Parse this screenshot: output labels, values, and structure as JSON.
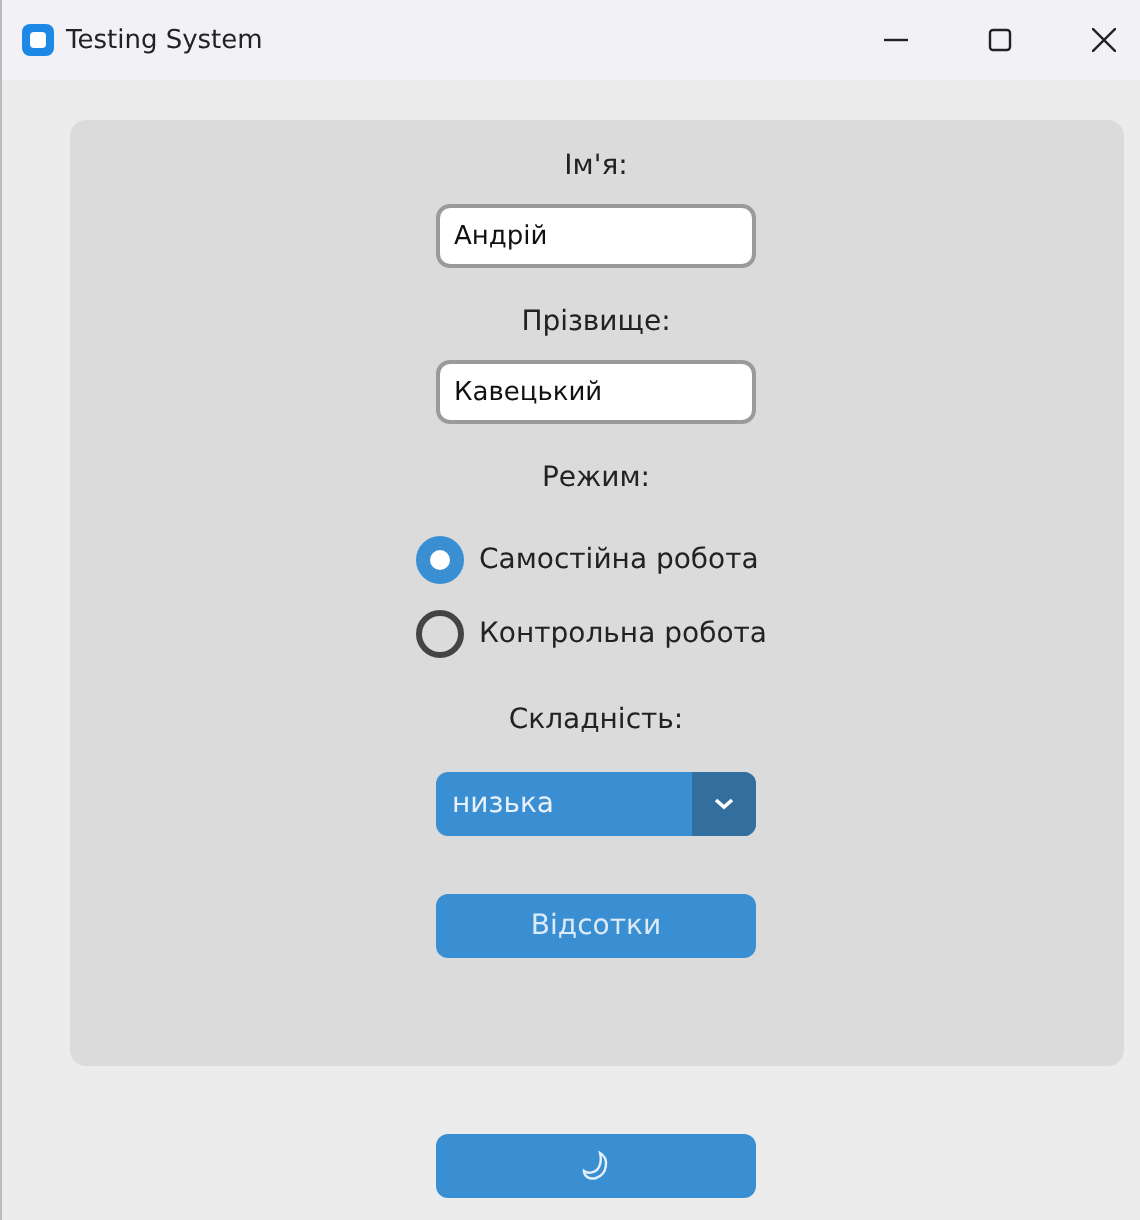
{
  "window": {
    "title": "Testing System"
  },
  "fields": [
    {
      "label": "Ім'я:",
      "value": "Андрій"
    },
    {
      "label": "Прізвище:",
      "value": "Кавецький"
    }
  ],
  "mode": {
    "label": "Режим:",
    "options": [
      {
        "label": "Самостійна робота",
        "selected": true
      },
      {
        "label": "Контрольна робота",
        "selected": false
      }
    ]
  },
  "difficulty": {
    "label": "Складність:",
    "value": "низька"
  },
  "submit_button": "Відсотки"
}
